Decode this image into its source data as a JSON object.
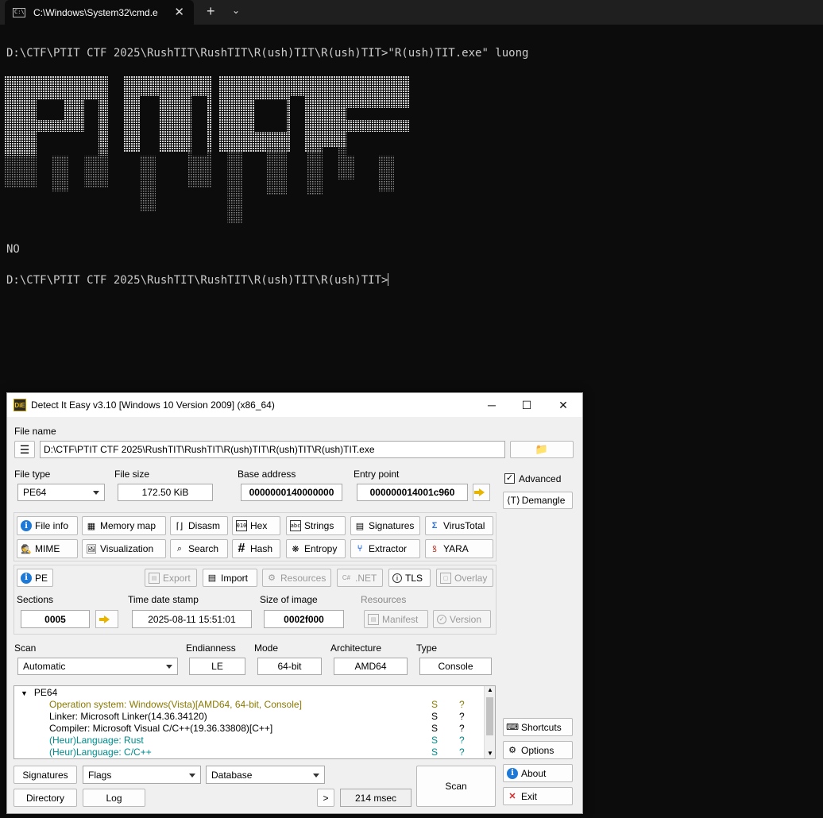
{
  "terminal": {
    "tab_title": "C:\\Windows\\System32\\cmd.e",
    "tab_icon": "terminal-icon",
    "command_line": "D:\\CTF\\PTIT CTF 2025\\RushTIT\\RushTIT\\R(ush)TIT\\R(ush)TIT>\"R(ush)TIT.exe\" luong",
    "banner_text": "PTITCTF",
    "output": "NO",
    "prompt": "D:\\CTF\\PTIT CTF 2025\\RushTIT\\RushTIT\\R(ush)TIT\\R(ush)TIT>"
  },
  "die": {
    "title": "Detect It Easy v3.10 [Windows 10 Version 2009] (x86_64)",
    "logo_text": "DiE",
    "file_name_label": "File name",
    "file_path": "D:\\CTF\\PTIT CTF 2025\\RushTIT\\RushTIT\\R(ush)TIT\\R(ush)TIT\\R(ush)TIT.exe",
    "file_type_label": "File type",
    "file_type": "PE64",
    "file_size_label": "File size",
    "file_size": "172.50 KiB",
    "base_address_label": "Base address",
    "base_address": "0000000140000000",
    "entry_point_label": "Entry point",
    "entry_point": "000000014001c960",
    "advanced_label": "Advanced",
    "demangle_label": "Demangle",
    "tools_row1": [
      "File info",
      "Memory map",
      "Disasm",
      "Hex",
      "Strings",
      "Signatures",
      "VirusTotal"
    ],
    "tools_row2": [
      "MIME",
      "Visualization",
      "Search",
      "Hash",
      "Entropy",
      "Extractor",
      "YARA"
    ],
    "pe_label": "PE",
    "pe_buttons": [
      "Export",
      "Import",
      "Resources",
      ".NET",
      "TLS",
      "Overlay"
    ],
    "sections_label": "Sections",
    "sections": "0005",
    "timestamp_label": "Time date stamp",
    "timestamp": "2025-08-11 15:51:01",
    "image_size_label": "Size of image",
    "image_size": "0002f000",
    "resources_label": "Resources",
    "manifest_label": "Manifest",
    "version_label": "Version",
    "scan_label": "Scan",
    "scan_mode": "Automatic",
    "endianness_label": "Endianness",
    "endianness": "LE",
    "mode_label": "Mode",
    "mode": "64-bit",
    "architecture_label": "Architecture",
    "architecture": "AMD64",
    "type_label": "Type",
    "type": "Console",
    "results_root": "PE64",
    "results": [
      {
        "text": "Operation system: Windows(Vista)[AMD64, 64-bit, Console]",
        "s": "S",
        "q": "?",
        "color": "#8a7a00"
      },
      {
        "text": "Linker: Microsoft Linker(14.36.34120)",
        "s": "S",
        "q": "?",
        "color": "#000000"
      },
      {
        "text": "Compiler: Microsoft Visual C/C++(19.36.33808)[C++]",
        "s": "S",
        "q": "?",
        "color": "#000000"
      },
      {
        "text": "(Heur)Language: Rust",
        "s": "S",
        "q": "?",
        "color": "#008b8b"
      },
      {
        "text": "(Heur)Language: C/C++",
        "s": "S",
        "q": "?",
        "color": "#008b8b"
      }
    ],
    "signatures_btn": "Signatures",
    "flags_label": "Flags",
    "database_label": "Database",
    "directory_btn": "Directory",
    "log_btn": "Log",
    "more_btn": ">",
    "scan_time": "214 msec",
    "scan_btn": "Scan",
    "shortcuts_btn": "Shortcuts",
    "options_btn": "Options",
    "about_btn": "About",
    "exit_btn": "Exit"
  }
}
